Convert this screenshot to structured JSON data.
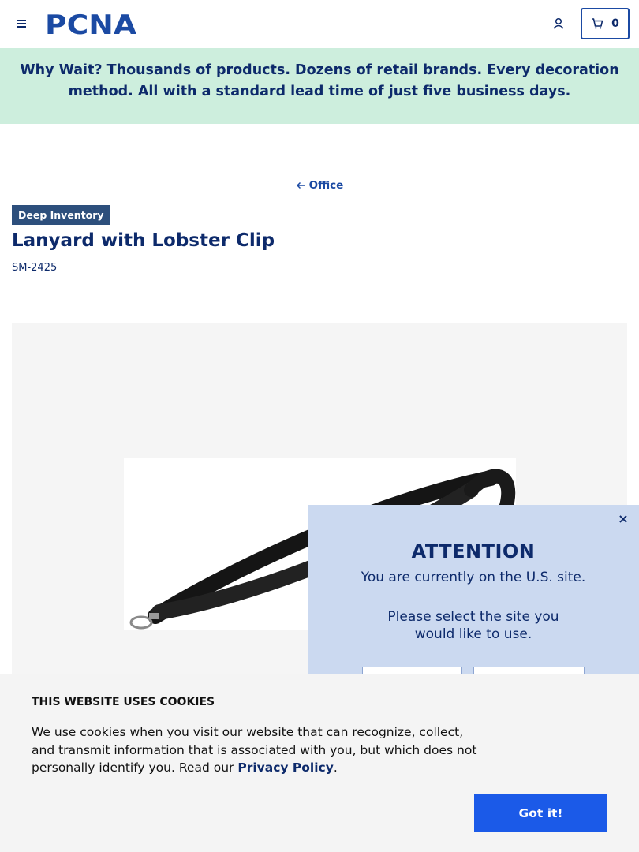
{
  "header": {
    "logo_text": "PCNA",
    "cart_count": "0",
    "icons": [
      "hamburger-menu-icon",
      "user-account-icon",
      "shopping-cart-icon"
    ]
  },
  "promo": {
    "text": "Why Wait? Thousands of products. Dozens of retail brands. Every decoration method. All with a standard lead time of just five business days."
  },
  "breadcrumb": {
    "label": "Office"
  },
  "product": {
    "badge": "Deep Inventory",
    "title": "Lanyard with Lobster Clip",
    "sku": "SM-2425"
  },
  "modal": {
    "close": "×",
    "title": "ATTENTION",
    "line1": "You are currently on the U.S. site.",
    "line2": "Please select the site you would like to use."
  },
  "cookie": {
    "title": "THIS WEBSITE USES COOKIES",
    "text": "We use cookies when you visit our website that can recognize, collect, and transmit information that is associated with you, but which does not personally identify you. Read our",
    "link": "Privacy Policy",
    "period": ".",
    "button": "Got it!"
  },
  "colors": {
    "navy": "#0d2a6b",
    "accent_blue": "#1b4aa3",
    "promo_bg": "#cdeedd",
    "badge_bg": "#2d4f7c",
    "modal_bg": "#cbd9f0",
    "cookie_button": "#1b5ae8"
  }
}
